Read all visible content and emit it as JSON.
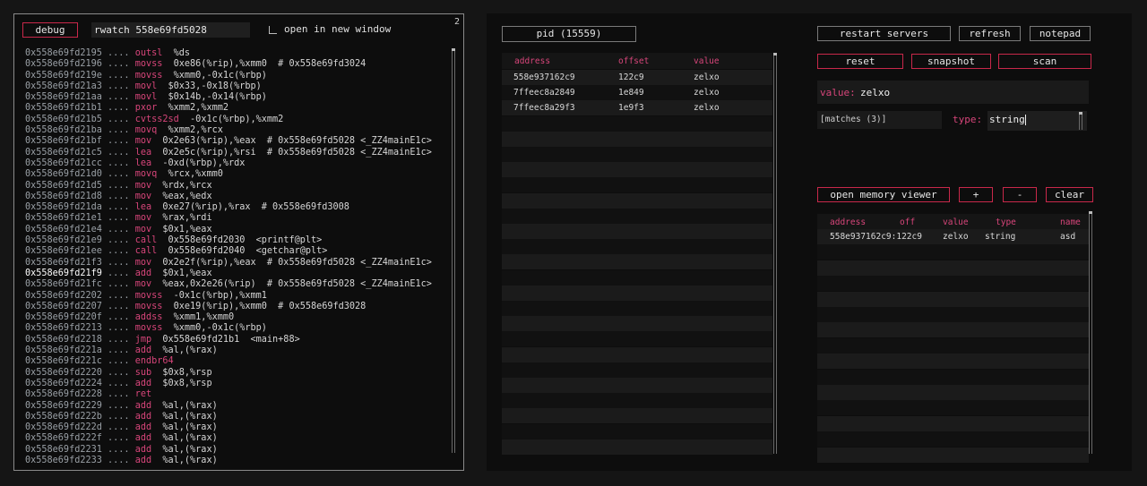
{
  "left": {
    "debug_label": "debug",
    "rwatch_value": "rwatch 558e69fd5028",
    "new_window_label": "open in new window",
    "panel_index": "2",
    "lines": [
      {
        "a": "0x558e69fd2195",
        "m": "outsl",
        "o": "%ds"
      },
      {
        "a": "0x558e69fd2196",
        "m": "movss",
        "o": "0xe86(%rip),%xmm0  # 0x558e69fd3024"
      },
      {
        "a": "0x558e69fd219e",
        "m": "movss",
        "o": "%xmm0,-0x1c(%rbp)"
      },
      {
        "a": "0x558e69fd21a3",
        "m": "movl",
        "o": "$0x33,-0x18(%rbp)"
      },
      {
        "a": "0x558e69fd21aa",
        "m": "movl",
        "o": "$0x14b,-0x14(%rbp)"
      },
      {
        "a": "0x558e69fd21b1",
        "m": "pxor",
        "o": "%xmm2,%xmm2"
      },
      {
        "a": "0x558e69fd21b5",
        "m": "cvtss2sd",
        "o": "-0x1c(%rbp),%xmm2"
      },
      {
        "a": "0x558e69fd21ba",
        "m": "movq",
        "o": "%xmm2,%rcx"
      },
      {
        "a": "0x558e69fd21bf",
        "m": "mov",
        "o": "0x2e63(%rip),%eax  # 0x558e69fd5028 <_ZZ4mainE1c>"
      },
      {
        "a": "0x558e69fd21c5",
        "m": "lea",
        "o": "0x2e5c(%rip),%rsi  # 0x558e69fd5028 <_ZZ4mainE1c>"
      },
      {
        "a": "0x558e69fd21cc",
        "m": "lea",
        "o": "-0xd(%rbp),%rdx"
      },
      {
        "a": "0x558e69fd21d0",
        "m": "movq",
        "o": "%rcx,%xmm0"
      },
      {
        "a": "0x558e69fd21d5",
        "m": "mov",
        "o": "%rdx,%rcx"
      },
      {
        "a": "0x558e69fd21d8",
        "m": "mov",
        "o": "%eax,%edx"
      },
      {
        "a": "0x558e69fd21da",
        "m": "lea",
        "o": "0xe27(%rip),%rax  # 0x558e69fd3008"
      },
      {
        "a": "0x558e69fd21e1",
        "m": "mov",
        "o": "%rax,%rdi"
      },
      {
        "a": "0x558e69fd21e4",
        "m": "mov",
        "o": "$0x1,%eax"
      },
      {
        "a": "0x558e69fd21e9",
        "m": "call",
        "o": "0x558e69fd2030  <printf@plt>"
      },
      {
        "a": "0x558e69fd21ee",
        "m": "call",
        "o": "0x558e69fd2040  <getchar@plt>"
      },
      {
        "a": "0x558e69fd21f3",
        "m": "mov",
        "o": "0x2e2f(%rip),%eax  # 0x558e69fd5028 <_ZZ4mainE1c>"
      },
      {
        "a": "0x558e69fd21f9",
        "m": "add",
        "o": "$0x1,%eax",
        "cur": true
      },
      {
        "a": "0x558e69fd21fc",
        "m": "mov",
        "o": "%eax,0x2e26(%rip)  # 0x558e69fd5028 <_ZZ4mainE1c>"
      },
      {
        "a": "0x558e69fd2202",
        "m": "movss",
        "o": "-0x1c(%rbp),%xmm1"
      },
      {
        "a": "0x558e69fd2207",
        "m": "movss",
        "o": "0xe19(%rip),%xmm0  # 0x558e69fd3028"
      },
      {
        "a": "0x558e69fd220f",
        "m": "addss",
        "o": "%xmm1,%xmm0"
      },
      {
        "a": "0x558e69fd2213",
        "m": "movss",
        "o": "%xmm0,-0x1c(%rbp)"
      },
      {
        "a": "0x558e69fd2218",
        "m": "jmp",
        "o": "0x558e69fd21b1  <main+88>"
      },
      {
        "a": "0x558e69fd221a",
        "m": "add",
        "o": "%al,(%rax)"
      },
      {
        "a": "0x558e69fd221c",
        "m": "endbr64",
        "o": ""
      },
      {
        "a": "0x558e69fd2220",
        "m": "sub",
        "o": "$0x8,%rsp"
      },
      {
        "a": "0x558e69fd2224",
        "m": "add",
        "o": "$0x8,%rsp"
      },
      {
        "a": "0x558e69fd2228",
        "m": "ret",
        "o": ""
      },
      {
        "a": "0x558e69fd2229",
        "m": "add",
        "o": "%al,(%rax)"
      },
      {
        "a": "0x558e69fd222b",
        "m": "add",
        "o": "%al,(%rax)"
      },
      {
        "a": "0x558e69fd222d",
        "m": "add",
        "o": "%al,(%rax)"
      },
      {
        "a": "0x558e69fd222f",
        "m": "add",
        "o": "%al,(%rax)"
      },
      {
        "a": "0x558e69fd2231",
        "m": "add",
        "o": "%al,(%rax)"
      },
      {
        "a": "0x558e69fd2233",
        "m": "add",
        "o": "%al,(%rax)"
      }
    ]
  },
  "right": {
    "pid_label": "pid (15559)",
    "addr_table": {
      "headers": [
        "address",
        "offset",
        "value"
      ],
      "rows": [
        [
          "558e937162c9",
          "122c9",
          "zelxo"
        ],
        [
          "7ffeec8a2849",
          "1e849",
          "zelxo"
        ],
        [
          "7ffeec8a29f3",
          "1e9f3",
          "zelxo"
        ]
      ]
    },
    "restart_label": "restart servers",
    "refresh_label": "refresh",
    "notepad_label": "notepad",
    "reset_label": "reset",
    "snapshot_label": "snapshot",
    "scan_label": "scan",
    "value_label": "value:",
    "value_input": "zelxo",
    "matches_text": "[matches (3)]",
    "type_label": "type:",
    "type_value": "string",
    "open_viewer_label": "open memory viewer",
    "plus_label": "+",
    "minus_label": "-",
    "clear_label": "clear",
    "watch_table": {
      "headers": [
        "address",
        "off",
        "value",
        "type",
        "name"
      ],
      "rows": [
        [
          "558e937162c9:122c9",
          "",
          "zelxo",
          "string",
          "asd"
        ]
      ]
    }
  }
}
